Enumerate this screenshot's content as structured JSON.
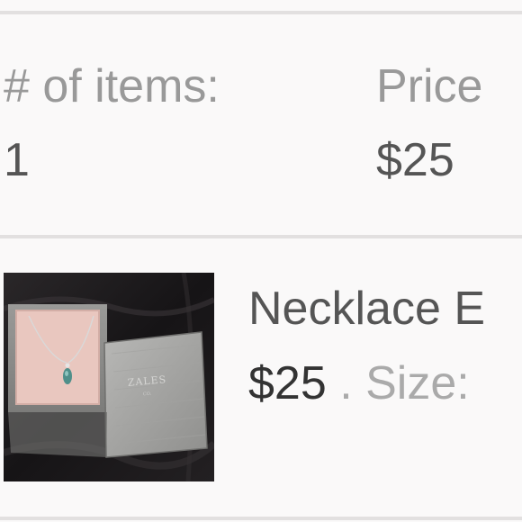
{
  "summary": {
    "count_label": "# of items:",
    "count_value": "1",
    "price_label": "Price",
    "price_value": "$25"
  },
  "item": {
    "title": "Necklace E",
    "price": "$25",
    "separator": " . ",
    "size_label": "Size:",
    "image": {
      "box_brand": "ZALES"
    }
  }
}
